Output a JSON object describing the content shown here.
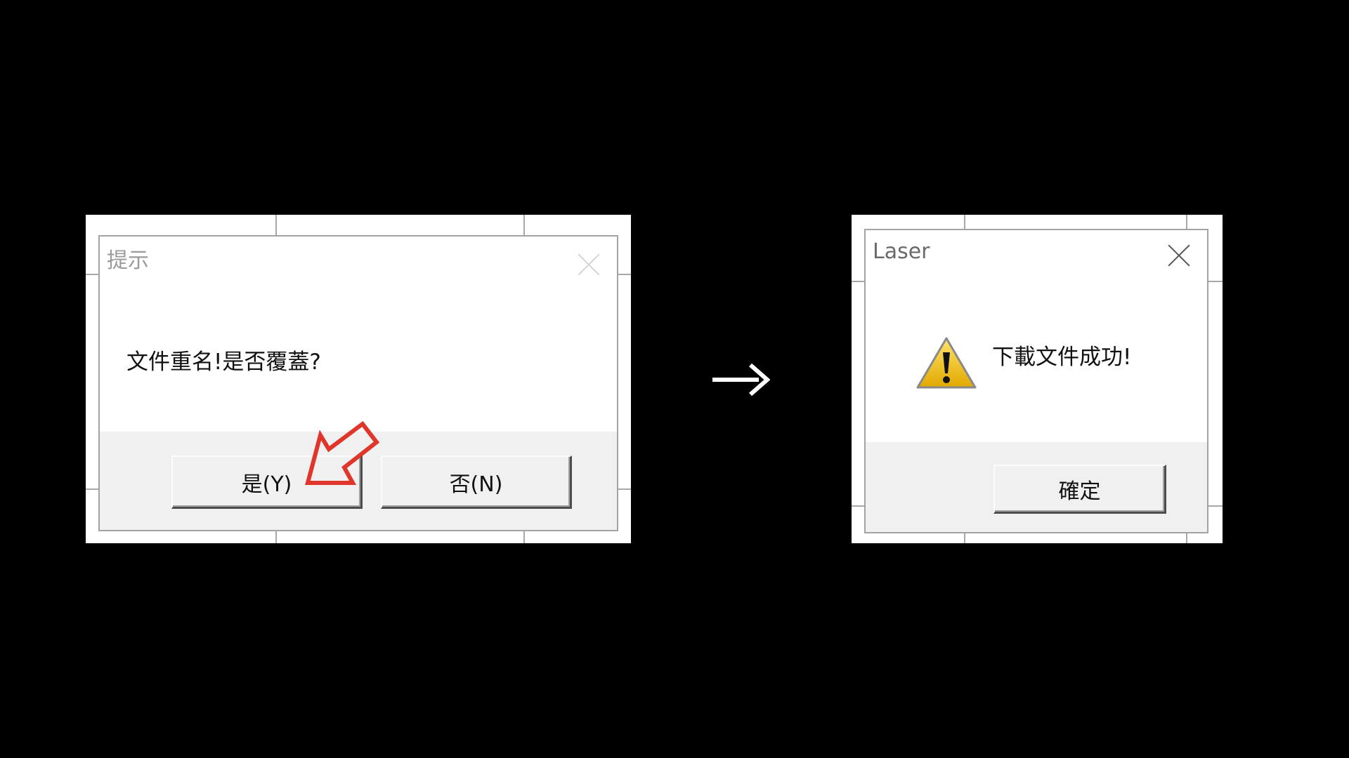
{
  "left_dialog": {
    "title": "提示",
    "message": "文件重名!是否覆蓋?",
    "yes_label": "是(Y)",
    "no_label": "否(N)"
  },
  "right_dialog": {
    "title": "Laser",
    "message": "下載文件成功!",
    "ok_label": "確定"
  },
  "colors": {
    "background": "#000000",
    "arrow": "#ffffff",
    "callout": "#e0352b",
    "warning": "#f2c318"
  },
  "icons": [
    "close-icon",
    "warning-icon",
    "right-arrow-icon",
    "callout-arrow-icon"
  ]
}
